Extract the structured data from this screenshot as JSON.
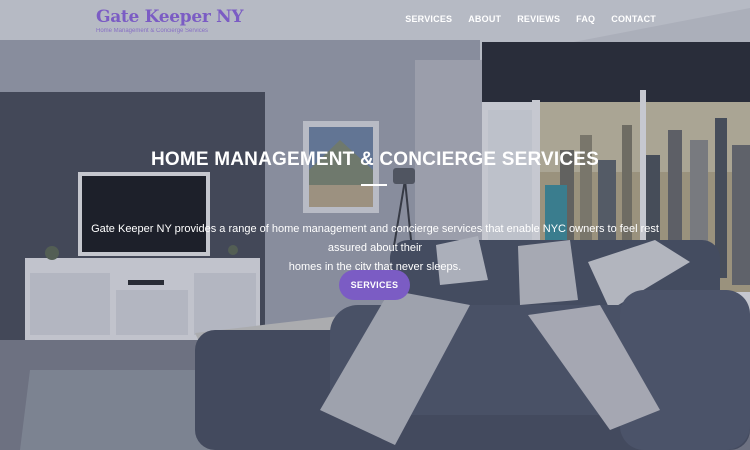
{
  "brand": {
    "name": "Gate Keeper NY",
    "tagline": "Home Management & Concierge Services"
  },
  "nav": {
    "items": [
      {
        "label": "SERVICES"
      },
      {
        "label": "ABOUT"
      },
      {
        "label": "REVIEWS"
      },
      {
        "label": "FAQ"
      },
      {
        "label": "CONTACT"
      }
    ]
  },
  "hero": {
    "title": "HOME MANAGEMENT & CONCIERGE SERVICES",
    "description_line1": "Gate Keeper NY provides a range of home management and concierge services that enable NYC owners to feel rest assured about their",
    "description_line2": "homes in the city that never sleeps.",
    "cta_label": "SERVICES"
  },
  "colors": {
    "accent": "#7b5cc4",
    "text_on_image": "#ffffff"
  }
}
